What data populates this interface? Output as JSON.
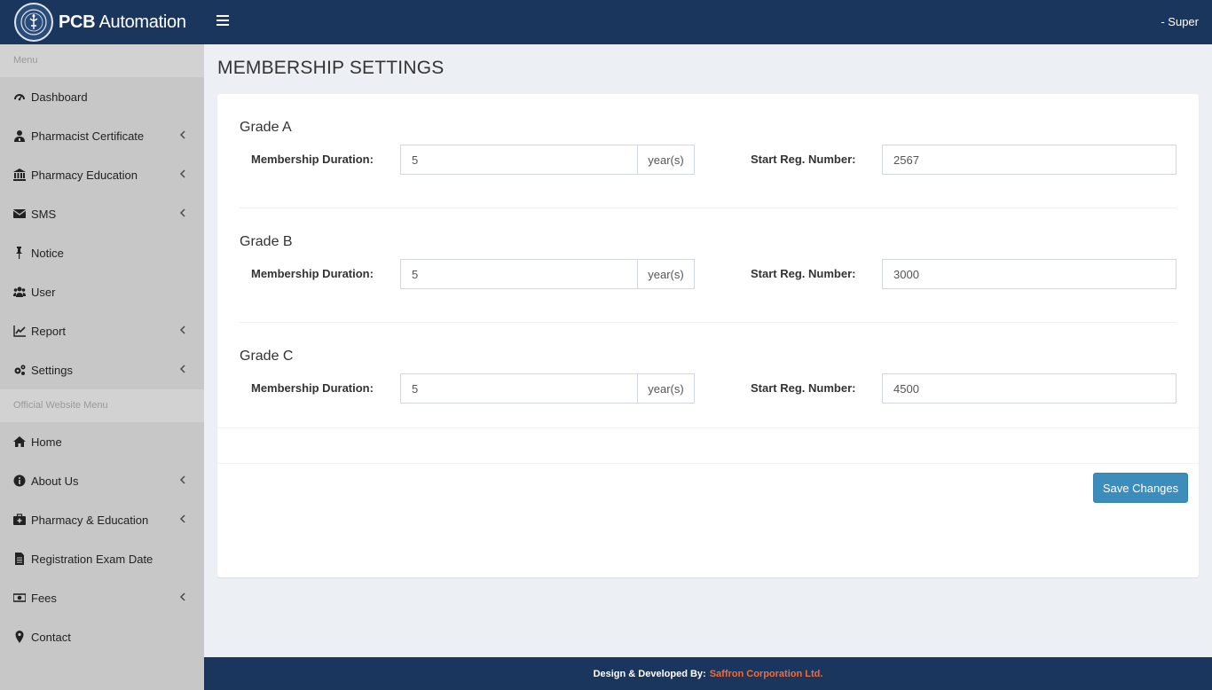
{
  "header": {
    "brand_bold": "PCB",
    "brand_rest": " Automation",
    "user": "- Super"
  },
  "sidebar": {
    "menu_header": "Menu",
    "items": [
      {
        "label": "Dashboard",
        "icon": "dashboard-icon",
        "has_submenu": false
      },
      {
        "label": "Pharmacist Certificate",
        "icon": "user-md-icon",
        "has_submenu": true
      },
      {
        "label": "Pharmacy Education",
        "icon": "institution-icon",
        "has_submenu": true
      },
      {
        "label": "SMS",
        "icon": "envelope-icon",
        "has_submenu": true
      },
      {
        "label": "Notice",
        "icon": "thumbtack-icon",
        "has_submenu": false
      },
      {
        "label": "User",
        "icon": "users-icon",
        "has_submenu": false
      },
      {
        "label": "Report",
        "icon": "line-chart-icon",
        "has_submenu": true
      },
      {
        "label": "Settings",
        "icon": "cogs-icon",
        "has_submenu": true
      }
    ],
    "website_header": "Official Website Menu",
    "website_items": [
      {
        "label": "Home",
        "icon": "home-icon",
        "has_submenu": false
      },
      {
        "label": "About Us",
        "icon": "info-circle-icon",
        "has_submenu": true
      },
      {
        "label": "Pharmacy & Education",
        "icon": "medkit-icon",
        "has_submenu": true
      },
      {
        "label": "Registration Exam Date",
        "icon": "file-text-icon",
        "has_submenu": false
      },
      {
        "label": "Fees",
        "icon": "money-icon",
        "has_submenu": true
      },
      {
        "label": "Contact",
        "icon": "map-marker-icon",
        "has_submenu": false
      }
    ]
  },
  "main": {
    "title": "MEMBERSHIP SETTINGS",
    "duration_label": "Membership Duration:",
    "duration_unit": "year(s)",
    "reg_label": "Start Reg. Number:",
    "grades": [
      {
        "name": "Grade A",
        "duration": "5",
        "start_reg": "2567"
      },
      {
        "name": "Grade B",
        "duration": "5",
        "start_reg": "3000"
      },
      {
        "name": "Grade C",
        "duration": "5",
        "start_reg": "4500"
      }
    ],
    "save_label": "Save Changes"
  },
  "footer": {
    "prefix": "Design & Developed By:",
    "company": "Saffron Corporation Ltd."
  },
  "colors": {
    "header_bg": "#1b365d",
    "sidebar_bg": "#c7c7c7",
    "primary_button": "#3c8dbc",
    "footer_accent": "#f26b3a"
  }
}
